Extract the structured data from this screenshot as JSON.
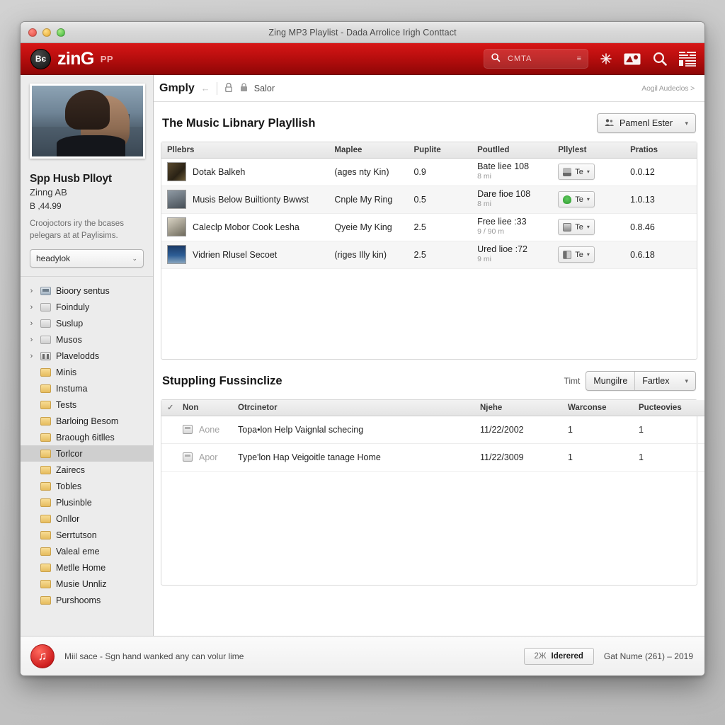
{
  "window": {
    "title": "Zing MP3 Playlist - Dada Arrolice Irigh Conttact"
  },
  "appbar": {
    "badge": "Bє",
    "brand": "zinG",
    "brand_sub": "PP",
    "search": {
      "icon": "search-icon",
      "keyword": "CMTA",
      "caret": "≡"
    },
    "icons": [
      "sparkle-icon",
      "media-icon",
      "search-icon",
      "list-view-icon"
    ]
  },
  "sidebar": {
    "promo": {
      "image_alt": "album-artwork",
      "title": "Spp Husb Plloyt",
      "by": "Zinng AB",
      "price": "В ,44.99",
      "description": "Croojoctors iry the bcases pelegars at at Paylisims.",
      "select_value": "headylok",
      "select_chevron": "⌄"
    },
    "tree": [
      {
        "label": "Bioory sentus",
        "icon": "app-icon",
        "twisty": "›",
        "child": false,
        "selected": false
      },
      {
        "label": "Foinduly",
        "icon": "folder-grey",
        "twisty": "›",
        "child": false,
        "selected": false
      },
      {
        "label": "Suslup",
        "icon": "folder-grey",
        "twisty": "›",
        "child": false,
        "selected": false
      },
      {
        "label": "Musos",
        "icon": "folder-grey",
        "twisty": "›",
        "child": false,
        "selected": false
      },
      {
        "label": "Plavelodds",
        "icon": "mixer-icon",
        "twisty": "›",
        "child": false,
        "selected": false
      },
      {
        "label": "Minis",
        "icon": "folder-yellow",
        "twisty": "",
        "child": true,
        "selected": false
      },
      {
        "label": "Instuma",
        "icon": "folder-yellow",
        "twisty": "",
        "child": true,
        "selected": false
      },
      {
        "label": "Tests",
        "icon": "folder-yellow",
        "twisty": "",
        "child": true,
        "selected": false
      },
      {
        "label": "Barloing Besom",
        "icon": "folder-yellow",
        "twisty": "",
        "child": true,
        "selected": false
      },
      {
        "label": "Braough 6itlles",
        "icon": "folder-yellow",
        "twisty": "",
        "child": true,
        "selected": false
      },
      {
        "label": "Torlcor",
        "icon": "folder-yellow",
        "twisty": "",
        "child": true,
        "selected": true
      },
      {
        "label": "Zairecs",
        "icon": "folder-yellow",
        "twisty": "",
        "child": true,
        "selected": false
      },
      {
        "label": "Tobles",
        "icon": "folder-yellow",
        "twisty": "",
        "child": true,
        "selected": false
      },
      {
        "label": "Plusinble",
        "icon": "folder-yellow",
        "twisty": "",
        "child": true,
        "selected": false
      },
      {
        "label": "Onllor",
        "icon": "folder-yellow",
        "twisty": "",
        "child": true,
        "selected": false
      },
      {
        "label": "Serrtutson",
        "icon": "folder-yellow",
        "twisty": "",
        "child": true,
        "selected": false
      },
      {
        "label": "Valeal eme",
        "icon": "folder-yellow",
        "twisty": "",
        "child": true,
        "selected": false
      },
      {
        "label": "Metlle Home",
        "icon": "folder-yellow",
        "twisty": "",
        "child": true,
        "selected": false
      },
      {
        "label": "Musie Unnliz",
        "icon": "folder-yellow",
        "twisty": "",
        "child": true,
        "selected": false
      },
      {
        "label": "Purshooms",
        "icon": "folder-yellow",
        "twisty": "",
        "child": true,
        "selected": false
      }
    ]
  },
  "breadcrumb": {
    "title": "Gmply",
    "arrow": "←",
    "lock_icon": "lock-icon",
    "sub": "Salor",
    "right_link": "Aogil Audeclos >"
  },
  "playlist_panel": {
    "title": "The Music Libnary Playllish",
    "action_button": {
      "icon": "people-icon",
      "label": "Pamenl Ester",
      "chevron": "▾"
    },
    "columns": [
      "Pllebrs",
      "Maplee",
      "Puplite",
      "Poutlled",
      "Pllylest",
      "Pratios"
    ],
    "rows": [
      {
        "thumb": "th-a",
        "name": "Dotak Balkeh",
        "maplee": "(ages nty Kin)",
        "puplite": "0.9",
        "poutlled_1": "Bate liee 108",
        "poutlled_2": "8 mi",
        "playlist_icon": "chart-icon",
        "playlist_label": "Te",
        "pratios": "0.0.12"
      },
      {
        "thumb": "th-b",
        "name": "Musis Below Builtionty Bwwst",
        "maplee": "Cnple My Ring",
        "puplite": "0.5",
        "poutlled_1": "Dare fioe 108",
        "poutlled_2": "8 mi",
        "playlist_icon": "leaf-icon",
        "playlist_label": "Te",
        "pratios": "1.0.13"
      },
      {
        "thumb": "th-c",
        "name": "Caleclp Mobor Cook Lesha",
        "maplee": "Qyeie My King",
        "puplite": "2.5",
        "poutlled_1": "Free liee :33",
        "poutlled_2": "9 / 90 m",
        "playlist_icon": "bell-icon",
        "playlist_label": "Te",
        "pratios": "0.8.46"
      },
      {
        "thumb": "th-d",
        "name": "Vidrien Rlusel Secoet",
        "maplee": "(riges Illy kin)",
        "puplite": "2.5",
        "poutlled_1": "Ured lioe :72",
        "poutlled_2": "9 mi",
        "playlist_icon": "book-icon",
        "playlist_label": "Te",
        "pratios": "0.6.18"
      }
    ]
  },
  "second_panel": {
    "title": "Stuppling Fussinclize",
    "filter_label": "Timt",
    "filter_seg_1": "Mungilre",
    "filter_seg_2": "Fartlex",
    "filter_chevron": "▾",
    "columns": [
      "",
      "Non",
      "Otrcinetor",
      "Njehe",
      "Warconse",
      "Pucteovies"
    ],
    "header_check": "✓",
    "rows": [
      {
        "icon": "document-icon",
        "non": "Aone",
        "otrcinetor": "Topa•lon Help Vaignlal schecing",
        "njehe": "11/22/2002",
        "warconse": "1",
        "pucteovies": "1"
      },
      {
        "icon": "document-icon",
        "non": "Apor",
        "otrcinetor": "Type'lon Hap Veigoitle tanage Home",
        "njehe": "11/22/3009",
        "warconse": "1",
        "pucteovies": "1"
      }
    ]
  },
  "footer": {
    "badge_icon": "music-note-icon",
    "message": "Miil sace - Sgn hand wanked any can volur lime",
    "button_count": "2Ж",
    "button_label": "Iderered",
    "copyright": "Gat Nume (261) – 2019"
  }
}
